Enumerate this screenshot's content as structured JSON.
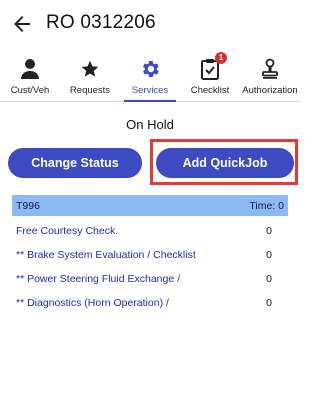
{
  "header": {
    "title": "RO 0312206",
    "back_icon": "arrow-left-icon"
  },
  "tabs": [
    {
      "label": "Cust/Veh",
      "icon": "person-icon",
      "active": false
    },
    {
      "label": "Requests",
      "icon": "star-icon",
      "active": false
    },
    {
      "label": "Services",
      "icon": "gear-icon",
      "active": true
    },
    {
      "label": "Checklist",
      "icon": "checklist-icon",
      "active": false,
      "badge": "1"
    },
    {
      "label": "Authorization",
      "icon": "stamp-icon",
      "active": false
    }
  ],
  "status": "On Hold",
  "buttons": {
    "change_status": "Change Status",
    "add_quickjob": "Add QuickJob"
  },
  "jobs": {
    "header": {
      "name": "T996",
      "time_label": "Time: 0"
    },
    "rows": [
      {
        "name": "Free Courtesy Check.",
        "value": "0"
      },
      {
        "name": "** Brake System Evaluation / Checklist",
        "value": "0"
      },
      {
        "name": "** Power Steering Fluid Exchange /",
        "value": "0"
      },
      {
        "name": "** Diagnostics (Horn Operation) /",
        "value": "0"
      }
    ]
  },
  "colors": {
    "accent": "#3b49d1",
    "button": "#3c4bc1",
    "highlight_box": "#e53a3a",
    "job_header_bg": "#8db9f2",
    "job_link": "#1f2bb8",
    "badge": "#d32f2f"
  }
}
